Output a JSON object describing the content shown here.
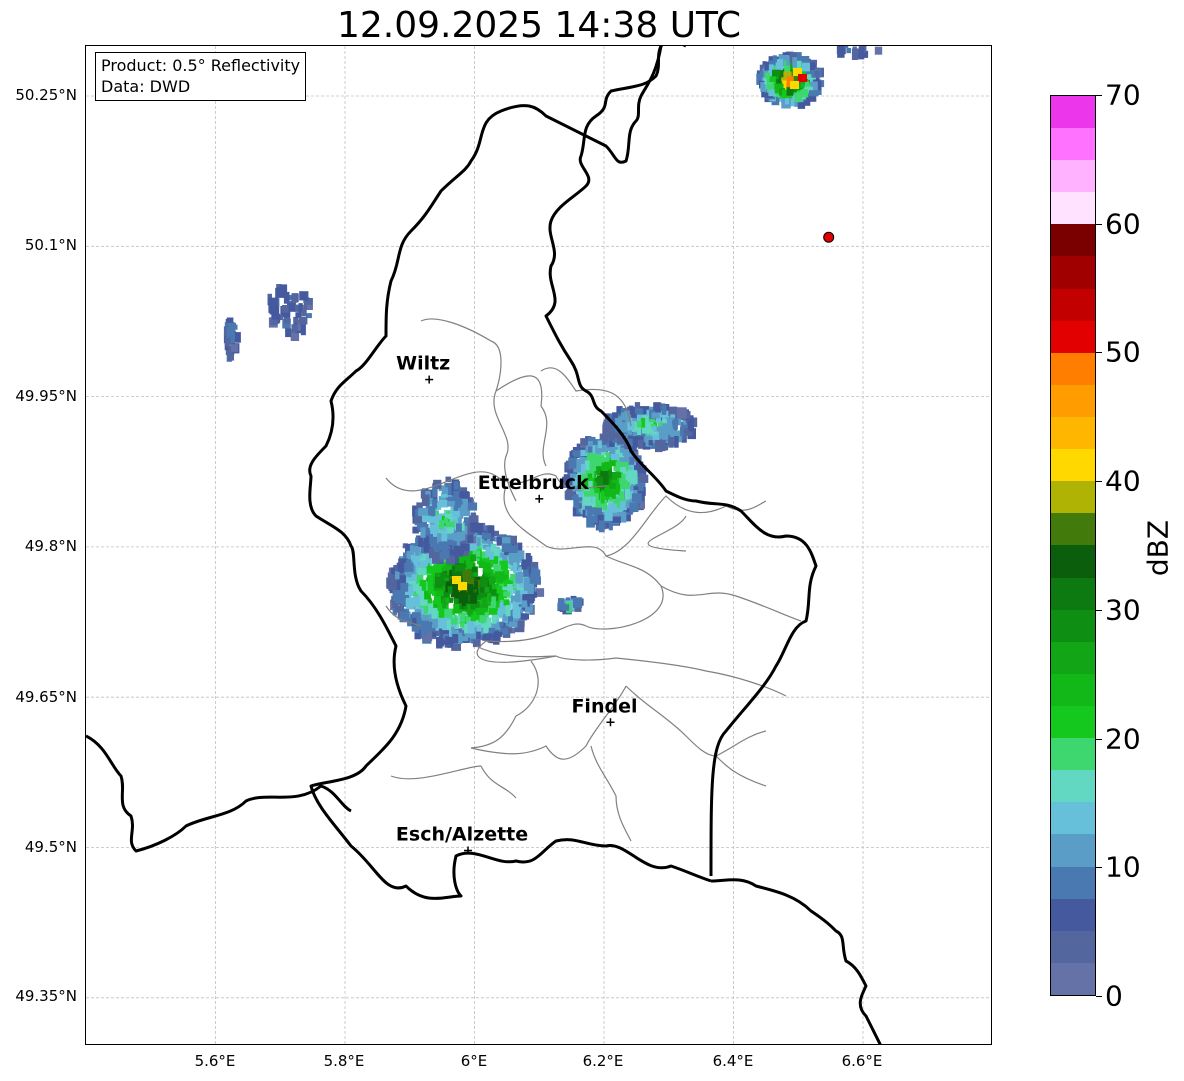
{
  "title": "12.09.2025 14:38 UTC",
  "info_box": {
    "product": "Product: 0.5° Reflectivity",
    "source": "Data: DWD"
  },
  "lat_labels": [
    "50.25°N",
    "50.1°N",
    "49.95°N",
    "49.8°N",
    "49.65°N",
    "49.5°N",
    "49.35°N"
  ],
  "lon_labels": [
    "5.6°E",
    "5.8°E",
    "6°E",
    "6.2°E",
    "6.4°E",
    "6.6°E"
  ],
  "cities": [
    {
      "name": "Wiltz",
      "lon": 5.93,
      "lat": 49.967
    },
    {
      "name": "Ettelbruck",
      "lon": 6.1,
      "lat": 49.848
    },
    {
      "name": "Findel",
      "lon": 6.21,
      "lat": 49.625
    },
    {
      "name": "Esch/Alzette",
      "lon": 5.99,
      "lat": 49.497
    }
  ],
  "radar_site_marker": {
    "lon": 6.547,
    "lat": 50.109,
    "color": "#e00000"
  },
  "colorbar": {
    "label": "dBZ",
    "ticks": [
      "0",
      "10",
      "20",
      "30",
      "40",
      "50",
      "60",
      "70"
    ],
    "colors": [
      "#6472a8",
      "#54669e",
      "#44599e",
      "#4a78b0",
      "#5a9ec8",
      "#66c0da",
      "#62d8c2",
      "#3ed66e",
      "#14c81e",
      "#12b818",
      "#12a616",
      "#0e8e12",
      "#0c7a10",
      "#0a5e0c",
      "#437a0c",
      "#afb404",
      "#ffd800",
      "#ffb600",
      "#ff9c00",
      "#ff7e00",
      "#e20000",
      "#c20000",
      "#a00000",
      "#7a0000",
      "#ffe2ff",
      "#ffb2ff",
      "#ff72ff",
      "#ec36ec"
    ]
  },
  "legend_note": "",
  "colors": {
    "border": "#000000",
    "canton_border": "#808080",
    "grid": "#c0c0c0"
  }
}
